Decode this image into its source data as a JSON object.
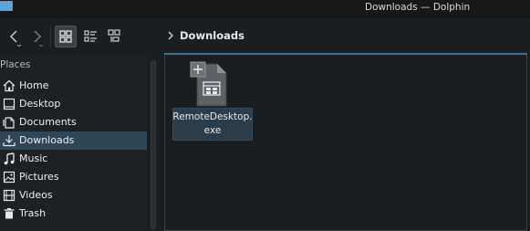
{
  "window": {
    "title": "Downloads — Dolphin"
  },
  "toolbar": {
    "back_icon": "chevron-left-icon",
    "forward_icon": "chevron-right-icon",
    "view_modes": [
      "icons-view-icon",
      "compact-view-icon",
      "details-view-icon"
    ],
    "active_view": "icons"
  },
  "breadcrumb": {
    "current": "Downloads"
  },
  "sidebar": {
    "section_label": "Places",
    "items": [
      {
        "label": "Home",
        "icon": "home-icon"
      },
      {
        "label": "Desktop",
        "icon": "desktop-icon"
      },
      {
        "label": "Documents",
        "icon": "documents-icon"
      },
      {
        "label": "Downloads",
        "icon": "downloads-icon",
        "active": true
      },
      {
        "label": "Music",
        "icon": "music-icon"
      },
      {
        "label": "Pictures",
        "icon": "pictures-icon"
      },
      {
        "label": "Videos",
        "icon": "videos-icon"
      },
      {
        "label": "Trash",
        "icon": "trash-icon"
      }
    ]
  },
  "files": [
    {
      "name": "RemoteDesktop.exe",
      "icon": "executable-file-icon",
      "selected": true
    }
  ]
}
